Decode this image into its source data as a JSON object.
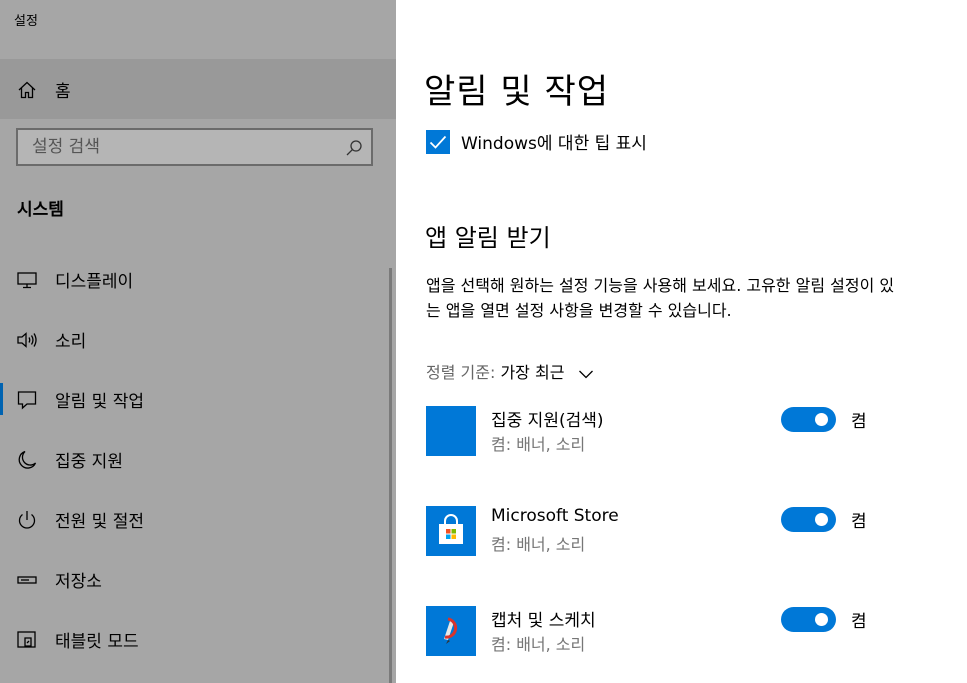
{
  "window": {
    "title": "설정"
  },
  "sidebar": {
    "home_label": "홈",
    "search_placeholder": "설정 검색",
    "section_title": "시스템",
    "items": [
      {
        "label": "디스플레이",
        "icon": "monitor-icon"
      },
      {
        "label": "소리",
        "icon": "speaker-icon"
      },
      {
        "label": "알림 및 작업",
        "icon": "notification-icon",
        "active": true
      },
      {
        "label": "집중 지원",
        "icon": "moon-icon"
      },
      {
        "label": "전원 및 절전",
        "icon": "power-icon"
      },
      {
        "label": "저장소",
        "icon": "storage-icon"
      },
      {
        "label": "태블릿 모드",
        "icon": "tablet-icon"
      }
    ]
  },
  "main": {
    "title": "알림 및 작업",
    "tips_checkbox": {
      "label": "Windows에 대한 팁 표시",
      "checked": true
    },
    "section_title": "앱 알림 받기",
    "description_line1": "앱을 선택해 원하는 설정 기능을 사용해 보세요. 고유한 알림 설정이 있",
    "description_line2": "는 앱을 열면 설정 사항을 변경할 수 있습니다.",
    "sort": {
      "label": "정렬 기준:",
      "value": "가장 최근"
    },
    "apps": [
      {
        "name": "집중 지원(검색)",
        "sub": "켬: 배너, 소리",
        "toggle_label": "켬",
        "on": true
      },
      {
        "name": "Microsoft Store",
        "sub": "켬: 배너, 소리",
        "toggle_label": "켬",
        "on": true
      },
      {
        "name": "캡처 및 스케치",
        "sub": "켬: 배너, 소리",
        "toggle_label": "켬",
        "on": true
      }
    ]
  },
  "colors": {
    "accent": "#0078d7",
    "sidebar_bg": "#a6a6a6",
    "active_bar": "#0063b1"
  }
}
